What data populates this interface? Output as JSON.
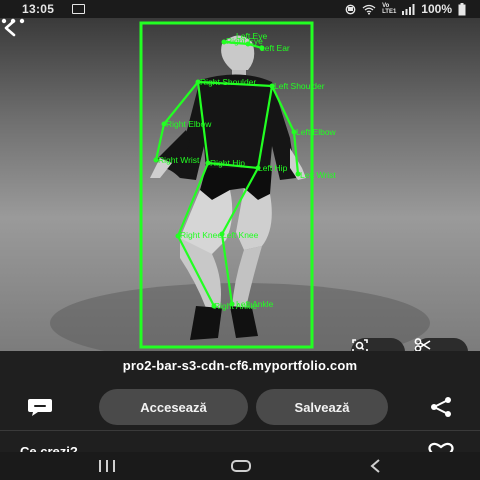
{
  "status": {
    "time": "13:05",
    "network_top": "Vo",
    "network_bottom": "LTE1",
    "battery": "100%"
  },
  "photo": {
    "labels": {
      "right_eye": "Right Eye",
      "left_eye": "Left Eye",
      "left_ear": "Left Ear",
      "right_shoulder": "Right Shoulder",
      "left_shoulder": "Left Shoulder",
      "right_elbow": "Right Elbow",
      "left_elbow": "Left Elbow",
      "right_wrist": "Right Wrist",
      "right_hip": "Right Hip",
      "left_hip": "Left Hip",
      "left_wrist": "Left Wrist",
      "right_knee": "Right Knee",
      "left_knee": "Left Knee",
      "right_ankle": "Right Ankle",
      "left_ankle": "Left Ankle"
    },
    "overlay_color": "#22ff22"
  },
  "url": "pro2-bar-s3-cdn-cf6.myportfolio.com",
  "actions": {
    "access_label": "Accesează",
    "save_label": "Salvează"
  },
  "comments": {
    "prompt": "Ce crezi?"
  },
  "icons": [
    "back-icon",
    "more-icon",
    "lens-icon",
    "scissors-icon",
    "comment-icon",
    "share-icon",
    "heart-icon"
  ]
}
